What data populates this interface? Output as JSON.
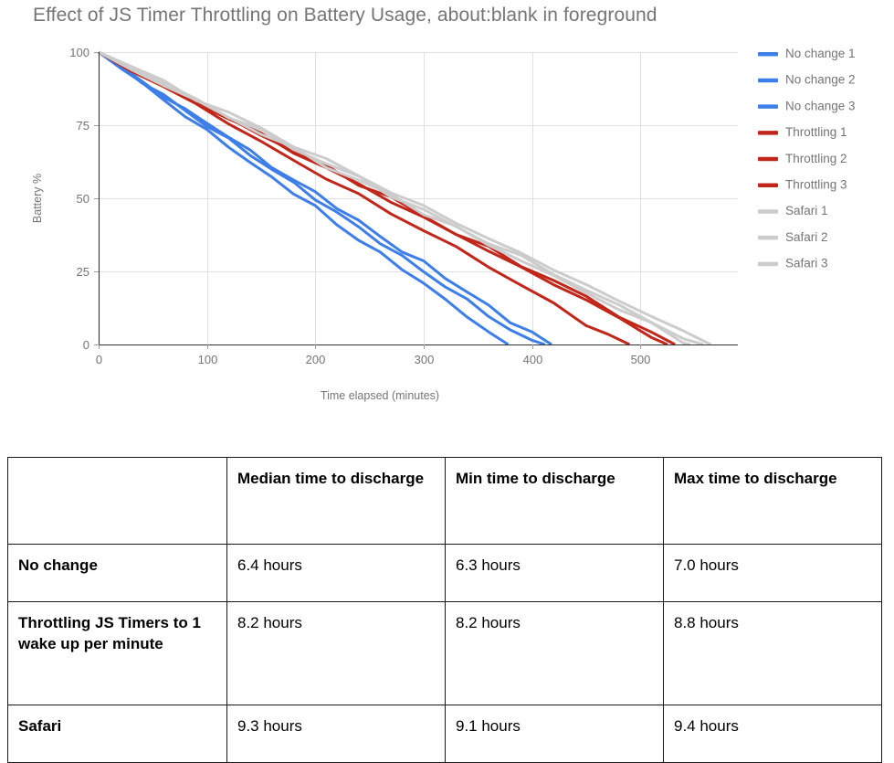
{
  "chart_data": {
    "type": "line",
    "title": "Effect of JS Timer Throttling on Battery Usage, about:blank in foreground",
    "xlabel": "Time elapsed (minutes)",
    "ylabel": "Battery %",
    "xlim": [
      0,
      590
    ],
    "ylim": [
      0,
      100
    ],
    "xticks": [
      0,
      100,
      200,
      300,
      400,
      500
    ],
    "yticks": [
      0,
      25,
      50,
      75,
      100
    ],
    "grid": true,
    "legend_position": "right",
    "colors": {
      "no_change": "#3d7ee8",
      "throttling": "#c0271a",
      "safari": "#cccccc",
      "grid": "#e0e0e0",
      "axis": "#333333",
      "text": "#757575"
    },
    "series": [
      {
        "name": "No change 1",
        "color": "#3d7ee8",
        "x": [
          0,
          20,
          40,
          60,
          80,
          100,
          120,
          140,
          160,
          180,
          200,
          220,
          240,
          260,
          280,
          300,
          320,
          340,
          360,
          378
        ],
        "values": [
          100,
          95,
          89,
          84,
          78,
          73,
          68,
          62,
          57,
          52,
          47,
          41,
          36,
          31,
          26,
          21,
          15,
          10,
          4,
          0
        ]
      },
      {
        "name": "No change 2",
        "color": "#3d7ee8",
        "x": [
          0,
          20,
          40,
          60,
          80,
          100,
          120,
          140,
          160,
          180,
          200,
          220,
          240,
          260,
          280,
          300,
          320,
          340,
          360,
          380,
          400,
          418
        ],
        "values": [
          100,
          95,
          90,
          85,
          80,
          76,
          71,
          66,
          61,
          56,
          52,
          47,
          42,
          37,
          32,
          28,
          23,
          18,
          13,
          8,
          4,
          0
        ]
      },
      {
        "name": "No change 3",
        "color": "#3d7ee8",
        "x": [
          0,
          20,
          40,
          60,
          80,
          100,
          120,
          140,
          160,
          180,
          200,
          220,
          240,
          260,
          280,
          300,
          320,
          340,
          360,
          380,
          400,
          412
        ],
        "values": [
          100,
          95,
          90,
          85,
          80,
          75,
          70,
          65,
          60,
          55,
          50,
          45,
          40,
          35,
          30,
          25,
          20,
          15,
          10,
          5,
          1,
          0
        ]
      },
      {
        "name": "Throttling 1",
        "color": "#c0271a",
        "x": [
          0,
          30,
          60,
          90,
          120,
          150,
          180,
          210,
          240,
          270,
          300,
          330,
          360,
          390,
          420,
          450,
          470,
          490
        ],
        "values": [
          100,
          94,
          88,
          82,
          76,
          69,
          63,
          57,
          51,
          45,
          39,
          33,
          27,
          20,
          14,
          7,
          3,
          0
        ]
      },
      {
        "name": "Throttling 2",
        "color": "#c0271a",
        "x": [
          0,
          30,
          60,
          90,
          120,
          150,
          180,
          210,
          240,
          270,
          300,
          330,
          360,
          390,
          420,
          450,
          480,
          510,
          525
        ],
        "values": [
          100,
          94,
          89,
          83,
          77,
          72,
          66,
          60,
          55,
          49,
          43,
          38,
          32,
          26,
          21,
          15,
          9,
          3,
          0
        ]
      },
      {
        "name": "Throttling 3",
        "color": "#c0271a",
        "x": [
          0,
          30,
          60,
          90,
          120,
          150,
          180,
          210,
          240,
          270,
          300,
          330,
          360,
          390,
          420,
          450,
          480,
          510,
          532
        ],
        "values": [
          100,
          94,
          89,
          83,
          77,
          72,
          66,
          61,
          55,
          50,
          44,
          38,
          33,
          27,
          22,
          16,
          10,
          4,
          0
        ]
      },
      {
        "name": "Safari 1",
        "color": "#cccccc",
        "x": [
          0,
          30,
          60,
          90,
          120,
          150,
          180,
          210,
          240,
          270,
          300,
          330,
          360,
          390,
          420,
          450,
          480,
          510,
          540,
          546
        ],
        "values": [
          100,
          94,
          89,
          83,
          78,
          72,
          67,
          61,
          56,
          51,
          45,
          40,
          34,
          29,
          23,
          18,
          12,
          7,
          1,
          0
        ]
      },
      {
        "name": "Safari 2",
        "color": "#cccccc",
        "x": [
          0,
          30,
          60,
          90,
          120,
          150,
          180,
          210,
          240,
          270,
          300,
          330,
          360,
          390,
          420,
          450,
          480,
          510,
          540,
          558
        ],
        "values": [
          100,
          95,
          89,
          84,
          78,
          73,
          67,
          62,
          57,
          51,
          46,
          40,
          35,
          30,
          24,
          19,
          13,
          8,
          2,
          0
        ]
      },
      {
        "name": "Safari 3",
        "color": "#cccccc",
        "x": [
          0,
          30,
          60,
          90,
          120,
          150,
          180,
          210,
          240,
          270,
          300,
          330,
          360,
          390,
          420,
          450,
          480,
          510,
          540,
          565
        ],
        "values": [
          100,
          95,
          90,
          84,
          79,
          74,
          68,
          63,
          58,
          52,
          47,
          42,
          36,
          31,
          26,
          20,
          15,
          10,
          4,
          0
        ]
      }
    ],
    "legend": [
      {
        "label": "No change 1",
        "color": "#3d7ee8"
      },
      {
        "label": "No change 2",
        "color": "#3d7ee8"
      },
      {
        "label": "No change 3",
        "color": "#3d7ee8"
      },
      {
        "label": "Throttling 1",
        "color": "#c0271a"
      },
      {
        "label": "Throttling 2",
        "color": "#c0271a"
      },
      {
        "label": "Throttling 3",
        "color": "#c0271a"
      },
      {
        "label": "Safari 1",
        "color": "#cccccc"
      },
      {
        "label": "Safari 2",
        "color": "#cccccc"
      },
      {
        "label": "Safari 3",
        "color": "#cccccc"
      }
    ]
  },
  "table": {
    "corner_label": "",
    "headers": [
      "Median time to discharge",
      "Min time to discharge",
      "Max time to discharge"
    ],
    "rows": [
      {
        "label": "No change",
        "median": "6.4 hours",
        "min": "6.3 hours",
        "max": "7.0 hours"
      },
      {
        "label": "Throttling JS Timers to 1 wake up per minute",
        "median": "8.2 hours",
        "min": "8.2 hours",
        "max": "8.8 hours"
      },
      {
        "label": "Safari",
        "median": "9.3 hours",
        "min": "9.1 hours",
        "max": "9.4 hours"
      }
    ]
  }
}
